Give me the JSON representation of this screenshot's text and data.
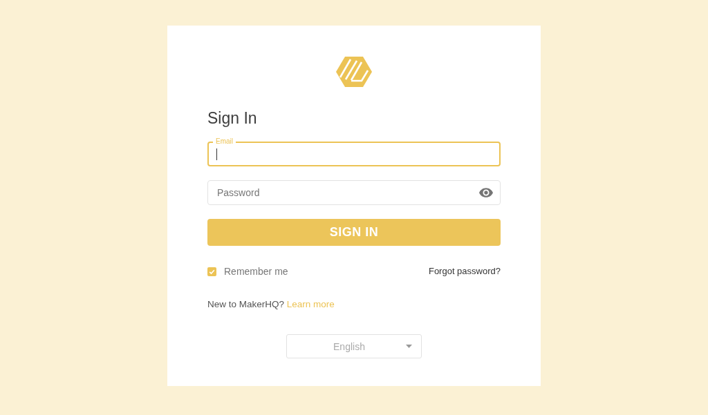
{
  "title": "Sign In",
  "email_field": {
    "label": "Email",
    "focused": true
  },
  "password_field": {
    "placeholder": "Password"
  },
  "sign_in_button": "SIGN IN",
  "remember_me": {
    "label": "Remember me",
    "checked": true
  },
  "forgot_password_link": "Forgot password?",
  "signup_prompt": {
    "text": "New to MakerHQ?",
    "link": "Learn more"
  },
  "language_select": {
    "value": "English"
  }
}
